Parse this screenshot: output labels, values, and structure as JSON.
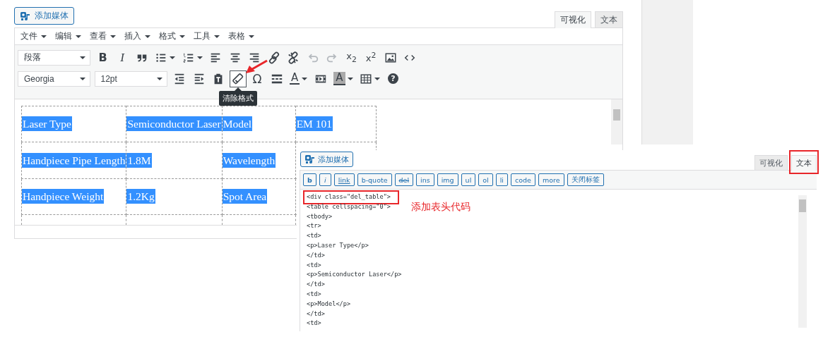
{
  "visual_editor": {
    "add_media": "添加媒体",
    "tabs": [
      {
        "label": "可视化",
        "selected": true
      },
      {
        "label": "文本",
        "selected": false
      }
    ],
    "menu": [
      "文件",
      "编辑",
      "查看",
      "插入",
      "格式",
      "工具",
      "表格"
    ],
    "toolbar_rows": [
      [
        {
          "kind": "select",
          "label": "段落"
        },
        {
          "kind": "bold",
          "label": "B"
        },
        {
          "kind": "italic",
          "label": "I"
        },
        {
          "kind": "blockquote"
        },
        {
          "kind": "bullet-list",
          "dropdown": true
        },
        {
          "kind": "numbered-list",
          "dropdown": true
        },
        {
          "kind": "align-left"
        },
        {
          "kind": "align-center"
        },
        {
          "kind": "align-right"
        },
        {
          "kind": "link"
        },
        {
          "kind": "unlink"
        },
        {
          "kind": "undo",
          "disabled": true
        },
        {
          "kind": "redo",
          "disabled": true
        },
        {
          "kind": "subscript",
          "label": "x$_{2}$"
        },
        {
          "kind": "superscript",
          "label": "x$^{2}$"
        },
        {
          "kind": "image"
        },
        {
          "kind": "code"
        }
      ],
      [
        {
          "kind": "select",
          "label": "Georgia"
        },
        {
          "kind": "select",
          "label": "12pt"
        },
        {
          "kind": "outdent"
        },
        {
          "kind": "indent"
        },
        {
          "kind": "paste-text"
        },
        {
          "kind": "clear-formatting",
          "active": true,
          "tooltip": "清除格式"
        },
        {
          "kind": "special-char",
          "label": "Ω"
        },
        {
          "kind": "horizontal-rule"
        },
        {
          "kind": "text-color",
          "label": "A",
          "dropdown": true
        },
        {
          "kind": "media"
        },
        {
          "kind": "background-color",
          "label": "A",
          "dropdown": true
        },
        {
          "kind": "table",
          "dropdown": true
        },
        {
          "kind": "help",
          "label": "?"
        }
      ]
    ],
    "table": {
      "rows": [
        [
          {
            "text": "Laser Type",
            "selected": true
          },
          {
            "text": "Semiconductor Laser",
            "selected": true
          },
          {
            "text": "Model",
            "selected": true
          },
          {
            "text": "EM 101",
            "selected": true
          }
        ],
        [
          {
            "text": "Handpiece Pipe Length",
            "selected": true
          },
          {
            "text": "1.8M",
            "selected": true
          },
          {
            "text": "Wavelength",
            "selected": true
          }
        ],
        [
          {
            "text": "Handpiece Weight",
            "selected": true
          },
          {
            "text": "1.2Kg",
            "selected": true
          },
          {
            "text": "Spot Area",
            "selected": true
          }
        ]
      ]
    }
  },
  "text_editor": {
    "add_media": "添加媒体",
    "tabs": [
      {
        "label": "可视化",
        "selected": false,
        "highlighted": false
      },
      {
        "label": "文本",
        "selected": true,
        "highlighted": true
      }
    ],
    "quicktags": [
      {
        "label": "b",
        "kind": "bold"
      },
      {
        "label": "i",
        "kind": "italic"
      },
      {
        "label": "link",
        "kind": "underline"
      },
      {
        "label": "b-quote",
        "kind": "plain"
      },
      {
        "label": "del",
        "kind": "strike"
      },
      {
        "label": "ins",
        "kind": "plain"
      },
      {
        "label": "img",
        "kind": "plain"
      },
      {
        "label": "ul",
        "kind": "plain"
      },
      {
        "label": "ol",
        "kind": "plain"
      },
      {
        "label": "li",
        "kind": "plain"
      },
      {
        "label": "code",
        "kind": "plain"
      },
      {
        "label": "more",
        "kind": "plain"
      },
      {
        "label": "关闭标签",
        "kind": "plain"
      }
    ],
    "code_lines": [
      {
        "text": "<div class=\"del_table\">",
        "highlighted": true
      },
      {
        "text": "<table cellspacing=\"0\">",
        "highlighted": false
      },
      {
        "text": "<tbody>",
        "highlighted": false
      },
      {
        "text": "<tr>",
        "highlighted": false
      },
      {
        "text": "<td>",
        "highlighted": false
      },
      {
        "text": "<p>Laser Type</p>",
        "highlighted": false
      },
      {
        "text": "</td>",
        "highlighted": false
      },
      {
        "text": "<td>",
        "highlighted": false
      },
      {
        "text": "<p>Semiconductor Laser</p>",
        "highlighted": false
      },
      {
        "text": "</td>",
        "highlighted": false
      },
      {
        "text": "<td>",
        "highlighted": false
      },
      {
        "text": "<p>Model</p>",
        "highlighted": false
      },
      {
        "text": "</td>",
        "highlighted": false
      },
      {
        "text": "<td>",
        "highlighted": false
      }
    ],
    "annotation": "添加表头代码"
  }
}
